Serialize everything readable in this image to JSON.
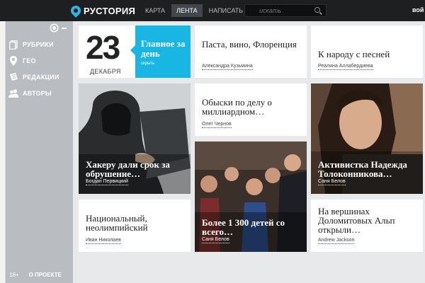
{
  "header": {
    "logo_text": "РУСТОРИЯ",
    "nav": [
      "КАРТА",
      "ЛЕНТА",
      "НАПИСАТЬ"
    ],
    "active_nav": 1,
    "search_placeholder": "искать",
    "login_label": "вой"
  },
  "sidebar": {
    "items": [
      {
        "label": "РУБРИКИ",
        "icon": "pages-icon"
      },
      {
        "label": "ГЕО",
        "icon": "map-pin-icon"
      },
      {
        "label": "РЕДАКЦИИ",
        "icon": "newspaper-icon"
      },
      {
        "label": "АВТОРЫ",
        "icon": "users-icon"
      }
    ],
    "age_rating": "18+",
    "about_label": "О ПРОЕКТЕ"
  },
  "feed": {
    "date_card": {
      "day": "23",
      "month": "ДЕКАБРЯ",
      "title": "Главное за день",
      "link": "скрыть"
    },
    "cards": [
      {
        "headline": "Паста, вино, Флоренция",
        "author": "Александра Кузьмина"
      },
      {
        "headline": "К народу с песней",
        "author": "Реалина Аллабердиева"
      },
      {
        "headline": "Хакеру дали срок за обрушение…",
        "author": "Богдан Первицкий"
      },
      {
        "headline": "Обыски по делу о миллиардном…",
        "author": "Олег Чернов"
      },
      {
        "headline": "Активистка Надежда Толоконникова…",
        "author": "Саня Белов"
      },
      {
        "headline": "Национальный, неолимпийский",
        "author": "Иван Николаев"
      },
      {
        "headline": "Более 1 300 детей со всего…",
        "author": "Саня Белов"
      },
      {
        "headline": "На вершинах Доломитовых Альп открыли…",
        "author": "Andrew Jackson"
      }
    ]
  },
  "colors": {
    "topbar": "#1e1f21",
    "sidebar": "#b9bcc0",
    "accent_blue": "#19b6e3",
    "background": "#e8e9ea"
  }
}
